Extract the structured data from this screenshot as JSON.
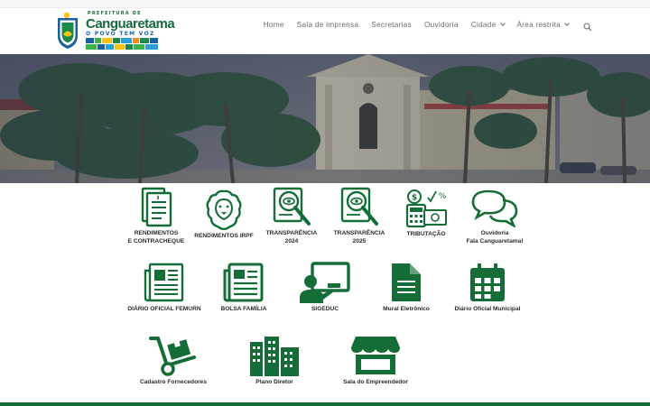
{
  "header": {
    "logo": {
      "pre_title": "PREFEITURA DE",
      "title": "Canguaretama",
      "slogan": "O POVO TEM VOZ"
    },
    "nav": [
      {
        "label": "Home",
        "dropdown": false
      },
      {
        "label": "Sala de imprensa",
        "dropdown": false
      },
      {
        "label": "Secretarias",
        "dropdown": false
      },
      {
        "label": "Ouvidoria",
        "dropdown": false
      },
      {
        "label": "Cidade",
        "dropdown": true
      },
      {
        "label": "Área restrita",
        "dropdown": true
      }
    ],
    "search_icon": "search-icon"
  },
  "hero": {
    "image": "town-square-church-palm-trees-photo"
  },
  "tiles": {
    "row1": [
      {
        "label": "RENDIMENTOS\nE CONTRACHEQUE",
        "icon": "document-icon"
      },
      {
        "label": "RENDIMENTOS IRPF",
        "icon": "lion-icon"
      },
      {
        "label": "TRANSPARÊNCIA\n2024",
        "icon": "magnifier-document-icon"
      },
      {
        "label": "TRANSPARÊNCIA\n2025",
        "icon": "magnifier-document-icon"
      },
      {
        "label": "TRIBUTAÇÃO",
        "icon": "calculator-money-icon"
      },
      {
        "label": "Ouvidoria\nFala Canguaretama!",
        "icon": "speech-bubbles-icon"
      }
    ],
    "row2": [
      {
        "label": "DIÁRIO OFICIAL FEMURN",
        "icon": "newspaper-icon"
      },
      {
        "label": "BOLSA FAMÍLIA",
        "icon": "newspaper-icon"
      },
      {
        "label": "SIGEDUC",
        "icon": "teacher-board-icon"
      },
      {
        "label": "Mural Eletrônico",
        "icon": "file-icon"
      },
      {
        "label": "Diário Oficial Municipal",
        "icon": "calendar-icon"
      }
    ],
    "row3": [
      {
        "label": "Cadastro Fornecedores",
        "icon": "hand-truck-icon"
      },
      {
        "label": "Plano Diretor",
        "icon": "city-buildings-icon"
      },
      {
        "label": "Sala do Empreendedor",
        "icon": "store-icon"
      }
    ]
  },
  "colors": {
    "brand_green": "#146d36",
    "nav_text": "#6a6a6a",
    "label_text": "#2b2b2b"
  }
}
